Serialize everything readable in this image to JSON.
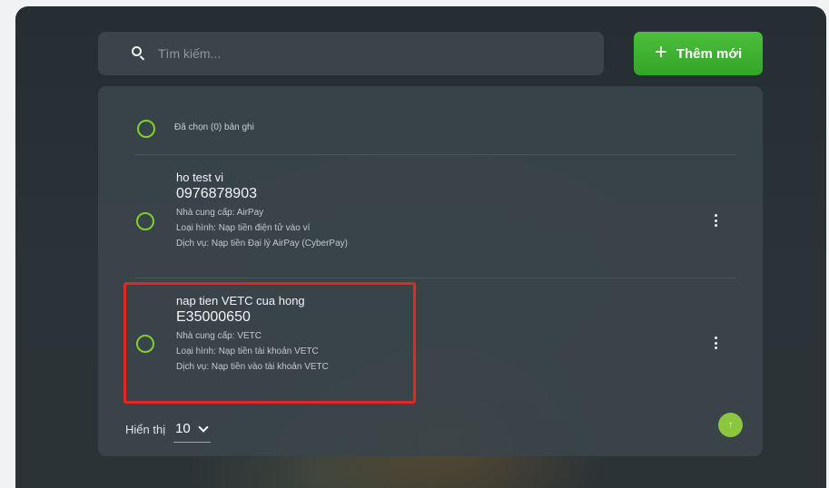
{
  "search": {
    "placeholder": "Tìm kiếm..."
  },
  "toolbar": {
    "add_label": "Thêm mới",
    "add_icon": "+"
  },
  "list": {
    "select_all_label": "Đã chọn (0) bản ghi",
    "records": [
      {
        "name": "ho test vi",
        "code": "0976878903",
        "provider": "Nhà cung cấp: AirPay",
        "type": "Loại hình: Nạp tiền điện tử vào ví",
        "service": "Dịch vụ: Nạp tiền Đại lý AirPay (CyberPay)"
      },
      {
        "name": "nap tien VETC cua hong",
        "code": "E35000650",
        "provider": "Nhà cung cấp: VETC",
        "type": "Loại hình: Nạp tiền tài khoản VETC",
        "service": "Dịch vụ: Nạp tiền vào tài khoản VETC"
      }
    ]
  },
  "pagination": {
    "label": "Hiển thị",
    "page_size": "10"
  },
  "scroll_top": {
    "icon": "↑"
  },
  "colors": {
    "accent": "#3fb233",
    "radio": "#7cd02f",
    "highlight": "#e32626",
    "panel": "#3a454a"
  }
}
